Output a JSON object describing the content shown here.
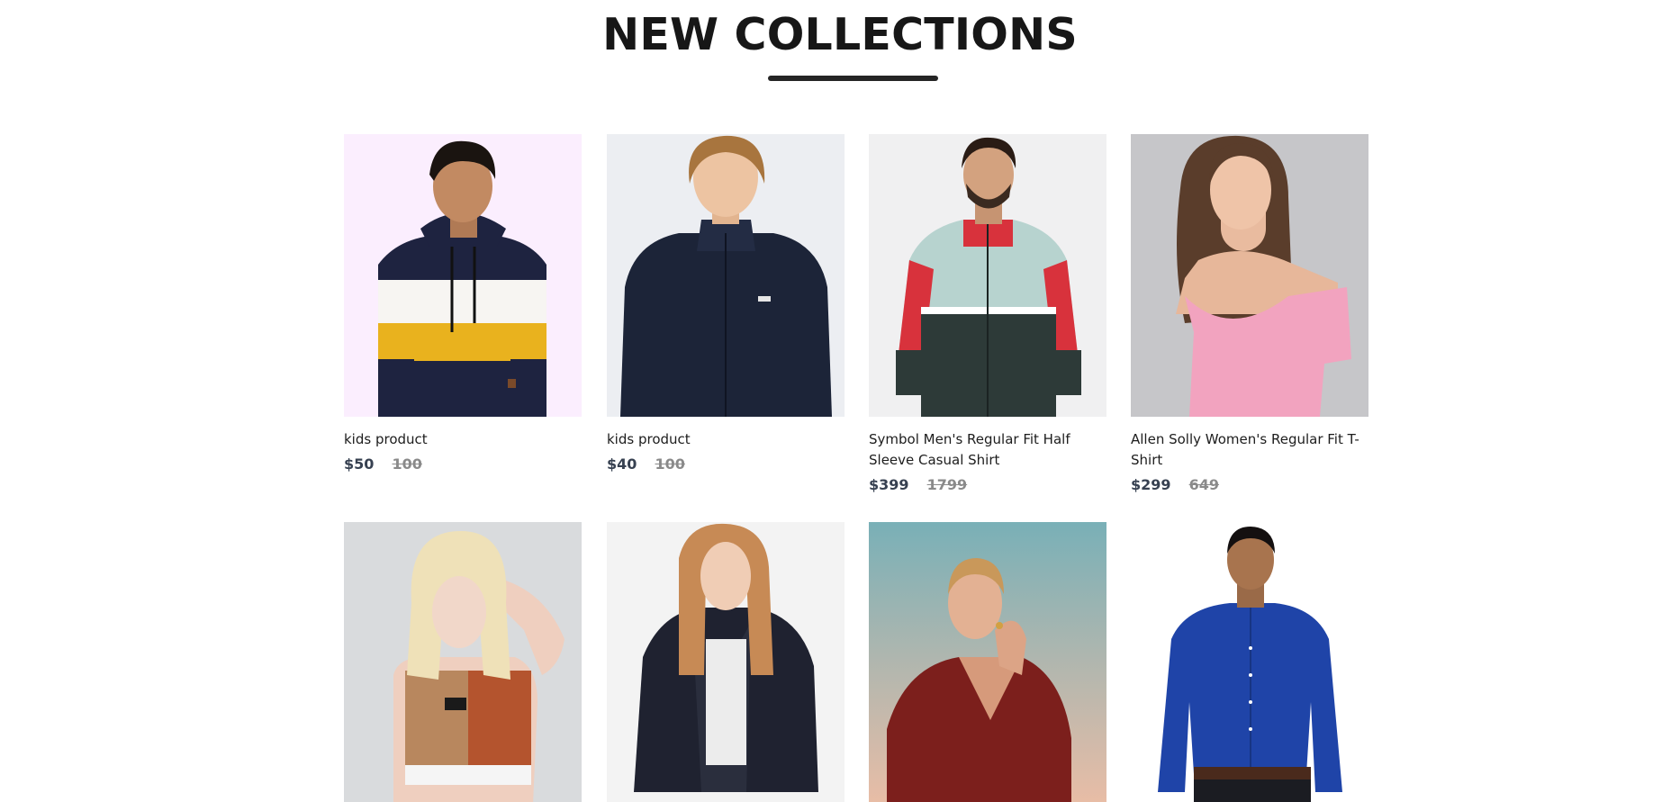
{
  "section": {
    "title": "NEW COLLECTIONS"
  },
  "products": [
    {
      "name": "kids product",
      "new_price": "$50",
      "old_price": "100",
      "image": "boy-striped-hoodie"
    },
    {
      "name": "kids product",
      "new_price": "$40",
      "old_price": "100",
      "image": "boy-navy-jacket"
    },
    {
      "name": "Symbol Men's Regular Fit Half Sleeve Casual Shirt",
      "new_price": "$399",
      "old_price": "1799",
      "image": "man-colorblock-jacket"
    },
    {
      "name": "Allen Solly Women's Regular Fit T-Shirt",
      "new_price": "$299",
      "old_price": "649",
      "image": "woman-pink-top"
    },
    {
      "name": "",
      "new_price": "",
      "old_price": "",
      "image": "woman-sports-crop-top"
    },
    {
      "name": "",
      "new_price": "",
      "old_price": "",
      "image": "woman-fur-jacket"
    },
    {
      "name": "",
      "new_price": "",
      "old_price": "",
      "image": "woman-red-check-top"
    },
    {
      "name": "",
      "new_price": "",
      "old_price": "",
      "image": "man-blue-shirt"
    }
  ],
  "colors": {
    "title": "#171717",
    "underline": "#252525",
    "price_new": "#374151",
    "price_old": "#8a8a8a"
  }
}
